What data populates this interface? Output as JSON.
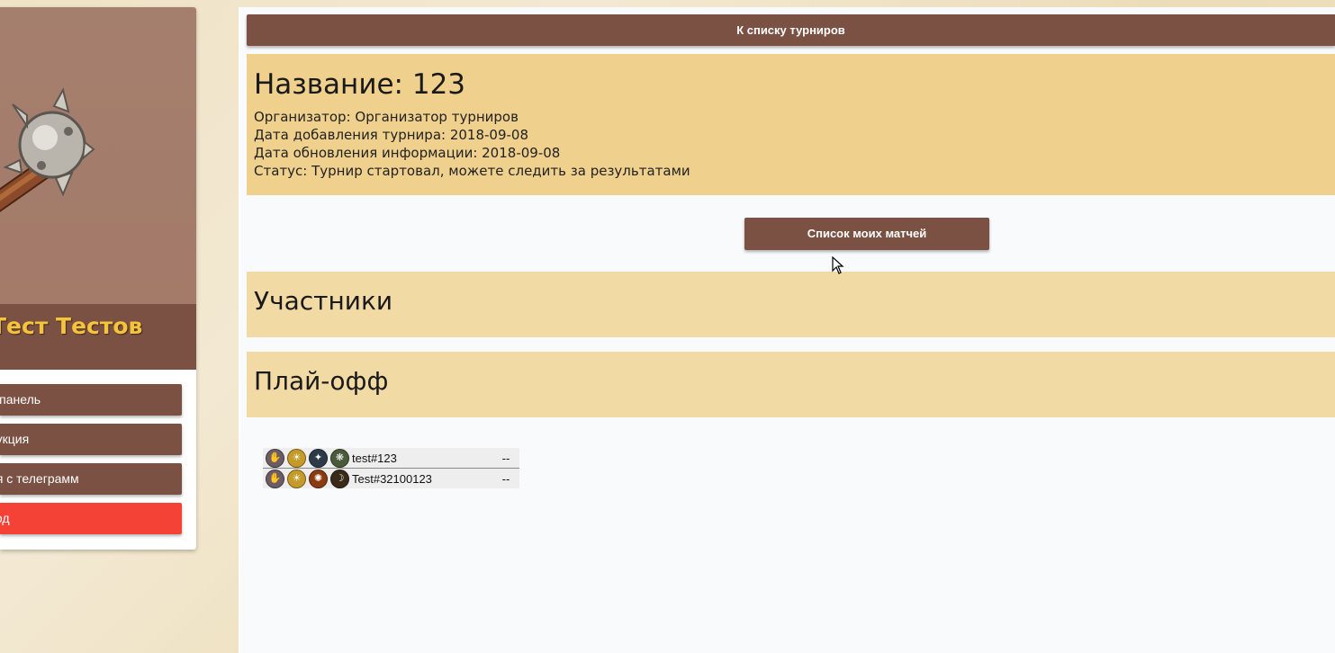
{
  "sidebar": {
    "user_name": "Тест Тестов",
    "buttons": [
      {
        "label": "ь панель"
      },
      {
        "label": "рукция"
      },
      {
        "label": "ия с телеграмм"
      },
      {
        "label": "ход"
      }
    ],
    "avatar_icon": "mace-icon"
  },
  "main": {
    "back_button": "К списку турниров",
    "tournament": {
      "title": "Название: 123",
      "organizer": "Организатор: Организатор турниров",
      "date_added": "Дата добавления турнира: 2018-09-08",
      "date_updated": "Дата обновления информации: 2018-09-08",
      "status": "Статус: Турнир стартовал, можете следить за результатами"
    },
    "my_matches_button": "Список моих матчей",
    "participants_heading": "Участники",
    "playoff_heading": "Плай-офф"
  },
  "bracket": {
    "match": [
      {
        "name": "test#123",
        "score": "--",
        "heroes": [
          "#6b5d66",
          "#c49a2a",
          "#2d3b48",
          "#4a5a3a"
        ]
      },
      {
        "name": "Test#32100123",
        "score": "--",
        "heroes": [
          "#6b5d66",
          "#c49a2a",
          "#8a3c10",
          "#3a2a1a"
        ]
      }
    ]
  },
  "colors": {
    "brand_brown": "#7a5143",
    "accent_yellow": "#f5c43b",
    "danger_red": "#f44336",
    "card_sand": "#efd08c",
    "section_sand": "#f2daa5"
  }
}
